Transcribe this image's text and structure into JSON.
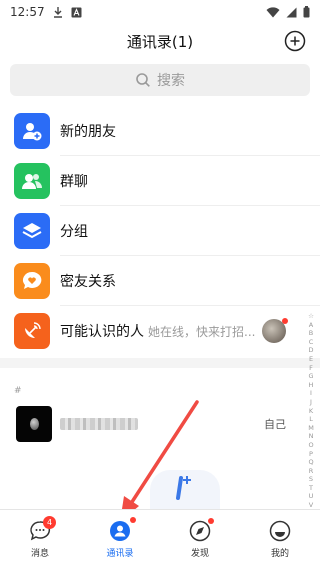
{
  "status_bar": {
    "time": "12:57"
  },
  "header": {
    "title": "通讯录(1)"
  },
  "search": {
    "placeholder": "搜索"
  },
  "menu": [
    {
      "label": "新的朋友",
      "icon": "add-friend-icon",
      "color": "#2b6cf6"
    },
    {
      "label": "群聊",
      "icon": "group-chat-icon",
      "color": "#25c25f"
    },
    {
      "label": "分组",
      "icon": "layers-icon",
      "color": "#2b6cf6"
    },
    {
      "label": "密友关系",
      "icon": "heart-bubble-icon",
      "color": "#fa8c1c"
    },
    {
      "label": "可能认识的人",
      "sub": "她在线，快来打招...",
      "icon": "radar-icon",
      "color": "#f5621c"
    }
  ],
  "index_letters": [
    "☆",
    "A",
    "B",
    "C",
    "D",
    "E",
    "F",
    "G",
    "H",
    "I",
    "J",
    "K",
    "L",
    "M",
    "N",
    "O",
    "P",
    "Q",
    "R",
    "S",
    "T",
    "U",
    "V",
    "W",
    "X",
    "Y",
    "Z",
    "#"
  ],
  "contacts": {
    "section": "#",
    "items": [
      {
        "tag": "自己"
      }
    ]
  },
  "tabs": [
    {
      "label": "消息",
      "icon": "message-icon",
      "badge": "4"
    },
    {
      "label": "通讯录",
      "icon": "contacts-icon",
      "active": true
    },
    {
      "label": "发现",
      "icon": "compass-icon",
      "dot": true
    },
    {
      "label": "我的",
      "icon": "profile-icon"
    }
  ],
  "colors": {
    "accent": "#1a6df0",
    "badge": "#ff3b30",
    "annotation": "#f04b43"
  }
}
